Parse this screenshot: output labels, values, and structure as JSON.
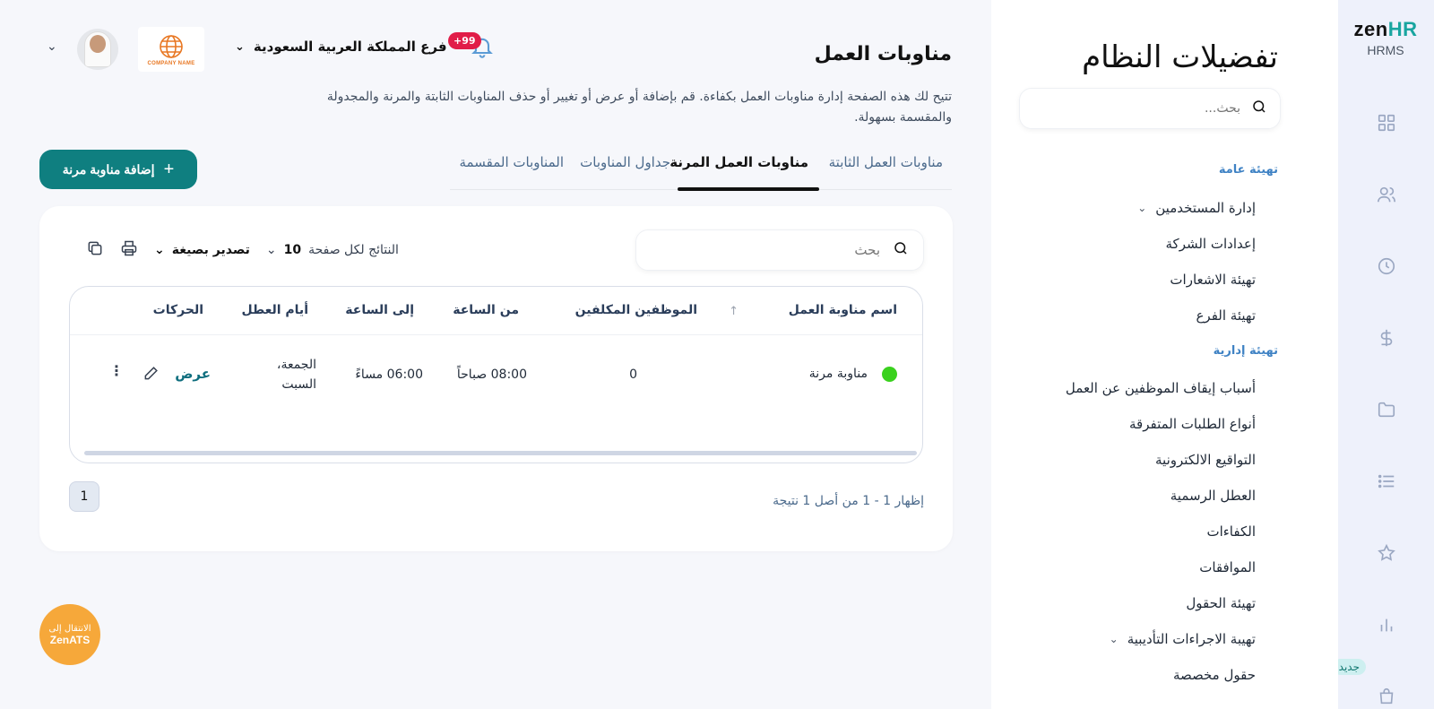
{
  "rail": {
    "logo_zen": "zen",
    "logo_hr": "HR",
    "logo_sub": "HRMS",
    "icons": [
      "grid-icon",
      "users-icon",
      "clock-icon",
      "dollar-icon",
      "folder-icon",
      "list-icon",
      "star-icon",
      "chart-icon",
      "bag-icon"
    ],
    "new_badge": "جديد"
  },
  "prefs": {
    "title": "تفضيلات النظام",
    "search_placeholder": "بحث...",
    "section_general": "تهيئة عامة",
    "general_items": [
      "إدارة المستخدمين",
      "إعدادات الشركة",
      "تهيئة الاشعارات",
      "تهيئة الفرع"
    ],
    "section_admin": "تهيئة إدارية",
    "admin_items": [
      "أسباب إيقاف الموظفين عن العمل",
      "أنواع الطلبات المتفرقة",
      "التواقيع الالكترونية",
      "العطل الرسمية",
      "الكفاءات",
      "الموافقات",
      "تهيئة الحقول",
      "تهيبة الاجراءات التأديبية",
      "حقول مخصصة"
    ]
  },
  "topbar": {
    "branch": "فرع المملكة العربية السعودية",
    "notifications_count": "+99",
    "company_logo_text": "COMPANY NAME"
  },
  "page": {
    "title": "مناوبات العمل",
    "description": "تتيح لك هذه الصفحة إدارة مناوبات العمل بكفاءة. قم بإضافة أو عرض أو تغيير أو حذف المناوبات الثابتة والمرنة والمجدولة والمقسمة بسهولة.",
    "tabs": [
      "مناوبات العمل الثابتة",
      "مناوبات العمل المرنة",
      "جداول المناوبات",
      "المناوبات المقسمة"
    ],
    "active_tab": "مناوبات العمل المرنة",
    "add_button": "إضافة مناوبة مرنة"
  },
  "table": {
    "search_placeholder": "بحث",
    "export_label": "تصدير بصيغة",
    "per_page_label": "النتائج لكل صفحة",
    "per_page_value": "10",
    "columns": [
      "اسم مناوبة العمل",
      "الموظفين المكلفين",
      "من الساعة",
      "إلى الساعة",
      "أيام العطل",
      "الحركات"
    ],
    "rows": [
      {
        "name": "مناوبة مرنة",
        "status_color": "#3ad11e",
        "employees": "0",
        "from": "08:00 صباحاً",
        "to": "06:00 مساءً",
        "days_off_line1": "الجمعة،",
        "days_off_line2": "السبت",
        "action_view": "عرض"
      }
    ],
    "pagination_info": "إظهار 1 - 1 من أصل 1 نتيجة",
    "current_page": "1"
  },
  "ats": {
    "line1": "الانتقال إلى",
    "line2": "ZenATS"
  },
  "colors": {
    "primary": "#0f7f80",
    "accent_blue": "#3f82c4",
    "badge_red": "#e11d48",
    "ats_orange": "#f6a83a"
  }
}
